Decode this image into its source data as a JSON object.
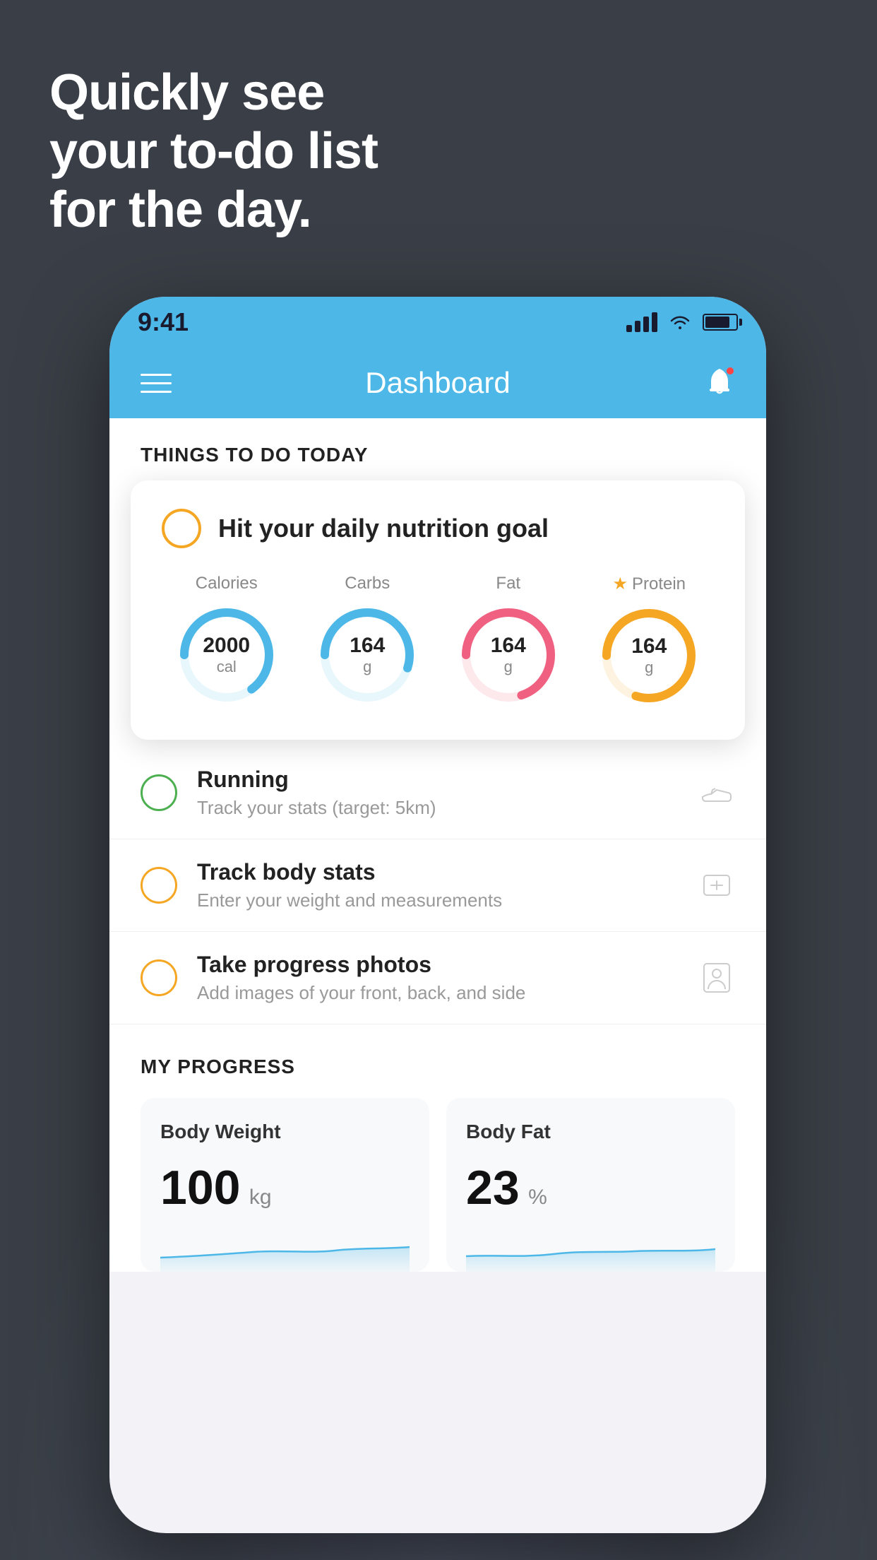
{
  "hero": {
    "line1": "Quickly see",
    "line2": "your to-do list",
    "line3": "for the day."
  },
  "phone": {
    "statusBar": {
      "time": "9:41"
    },
    "header": {
      "title": "Dashboard"
    },
    "thingsToDo": {
      "sectionLabel": "THINGS TO DO TODAY",
      "nutritionCard": {
        "title": "Hit your daily nutrition goal",
        "macros": [
          {
            "label": "Calories",
            "value": "2000",
            "unit": "cal",
            "color": "#4db8e8",
            "trackColor": "#e8f7fc",
            "progress": 0.65,
            "starred": false
          },
          {
            "label": "Carbs",
            "value": "164",
            "unit": "g",
            "color": "#4db8e8",
            "trackColor": "#e8f7fc",
            "progress": 0.55,
            "starred": false
          },
          {
            "label": "Fat",
            "value": "164",
            "unit": "g",
            "color": "#f06080",
            "trackColor": "#fde8ec",
            "progress": 0.7,
            "starred": false
          },
          {
            "label": "Protein",
            "value": "164",
            "unit": "g",
            "color": "#f5a623",
            "trackColor": "#fef3e0",
            "progress": 0.8,
            "starred": true
          }
        ]
      },
      "items": [
        {
          "id": "running",
          "title": "Running",
          "subtitle": "Track your stats (target: 5km)",
          "circleColor": "green",
          "iconType": "shoe"
        },
        {
          "id": "track-body-stats",
          "title": "Track body stats",
          "subtitle": "Enter your weight and measurements",
          "circleColor": "yellow",
          "iconType": "scale"
        },
        {
          "id": "progress-photos",
          "title": "Take progress photos",
          "subtitle": "Add images of your front, back, and side",
          "circleColor": "yellow",
          "iconType": "person"
        }
      ]
    },
    "myProgress": {
      "sectionLabel": "MY PROGRESS",
      "cards": [
        {
          "title": "Body Weight",
          "value": "100",
          "unit": "kg"
        },
        {
          "title": "Body Fat",
          "value": "23",
          "unit": "%"
        }
      ]
    }
  }
}
